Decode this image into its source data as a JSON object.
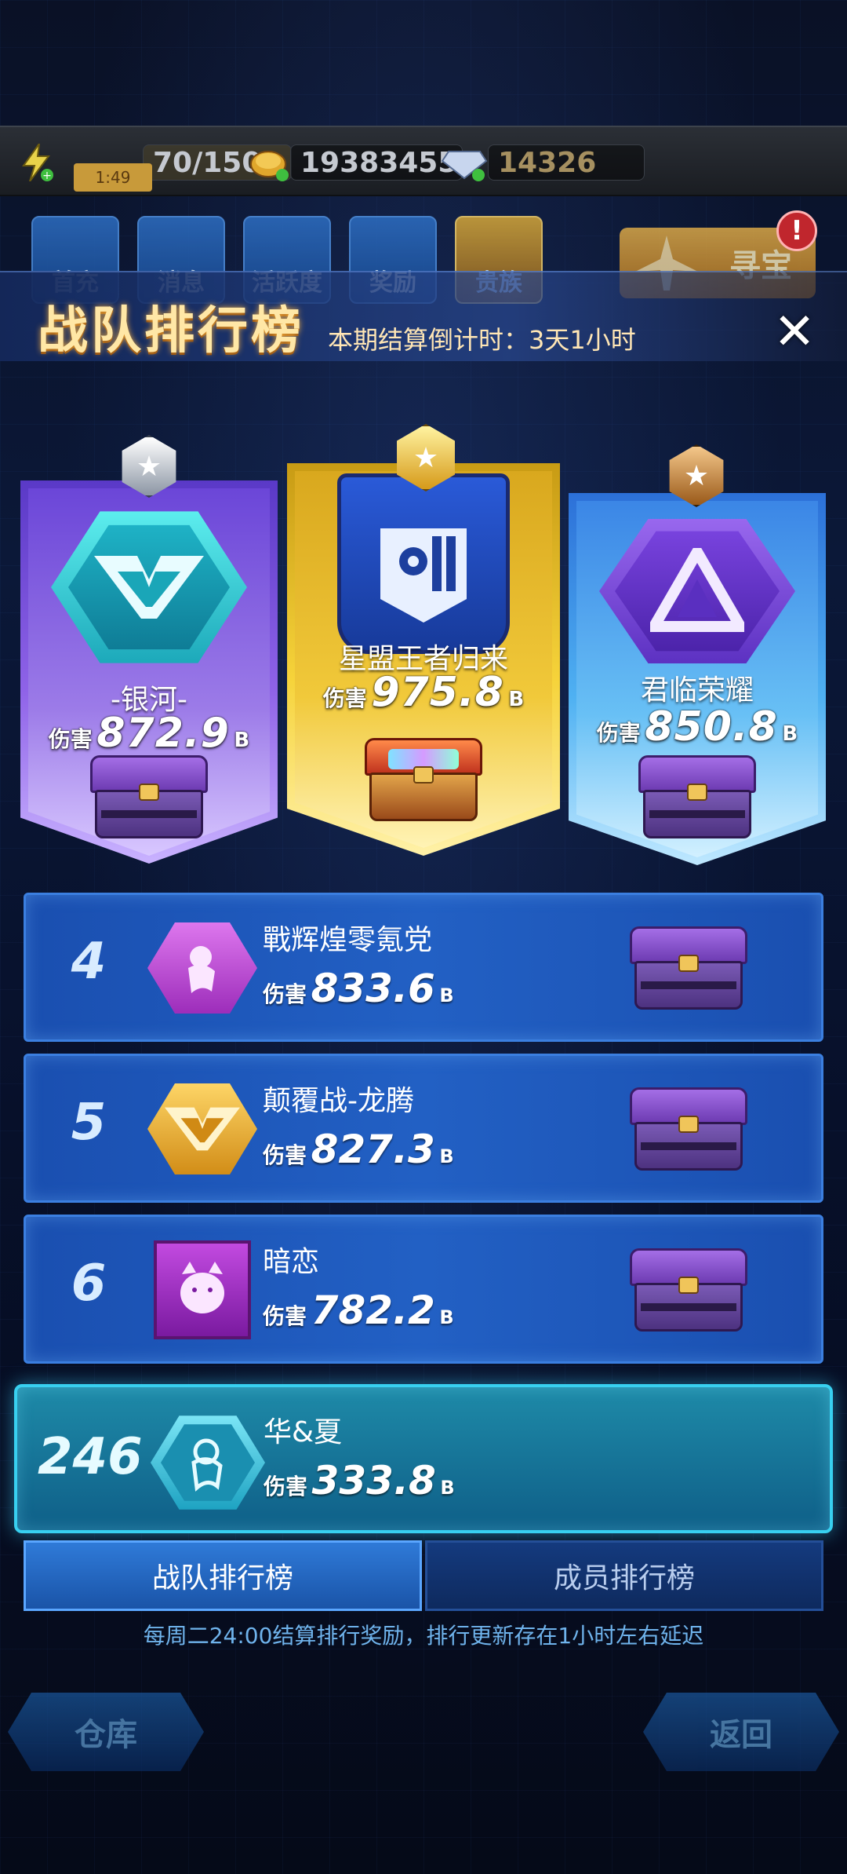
{
  "resources": {
    "energy_timer": "1:49",
    "energy": "70/150",
    "coins": "19383455",
    "gems": "14326"
  },
  "top_tabs": [
    {
      "label": "首充"
    },
    {
      "label": "消息"
    },
    {
      "label": "活跃度"
    },
    {
      "label": "奖励"
    },
    {
      "label": "贵族"
    }
  ],
  "treasure_button": "寻宝",
  "alert_badge": "!",
  "panel": {
    "title": "战队排行榜",
    "countdown": "本期结算倒计时：3天1小时",
    "close": "✕"
  },
  "podium": [
    {
      "rank": 2,
      "name": "-银河-",
      "dmg_label": "伤害",
      "dmg_value": "872.9",
      "dmg_unit": "B"
    },
    {
      "rank": 1,
      "name": "星盟王者归来",
      "dmg_label": "伤害",
      "dmg_value": "975.8",
      "dmg_unit": "B"
    },
    {
      "rank": 3,
      "name": "君临荣耀",
      "dmg_label": "伤害",
      "dmg_value": "850.8",
      "dmg_unit": "B"
    }
  ],
  "rows": [
    {
      "rank": "4",
      "name": "戰辉煌零氪党",
      "dmg_label": "伤害",
      "dmg_value": "833.6",
      "dmg_unit": "B"
    },
    {
      "rank": "5",
      "name": "颠覆战-龙腾",
      "dmg_label": "伤害",
      "dmg_value": "827.3",
      "dmg_unit": "B"
    },
    {
      "rank": "6",
      "name": "暗恋",
      "dmg_label": "伤害",
      "dmg_value": "782.2",
      "dmg_unit": "B"
    }
  ],
  "my_team": {
    "rank": "246",
    "name": "华&夏",
    "dmg_label": "伤害",
    "dmg_value": "333.8",
    "dmg_unit": "B"
  },
  "bottom_tabs": {
    "team_rank": "战队排行榜",
    "member_rank": "成员排行榜"
  },
  "footer_note": "每周二24:00结算排行奖励，排行更新存在1小时左右延迟",
  "nav": {
    "warehouse": "仓库",
    "back": "返回"
  },
  "colors": {
    "gold_title": "#ffe7a6",
    "row_blue": "#2260c4",
    "me_row_cyan": "#1e8aa8"
  }
}
